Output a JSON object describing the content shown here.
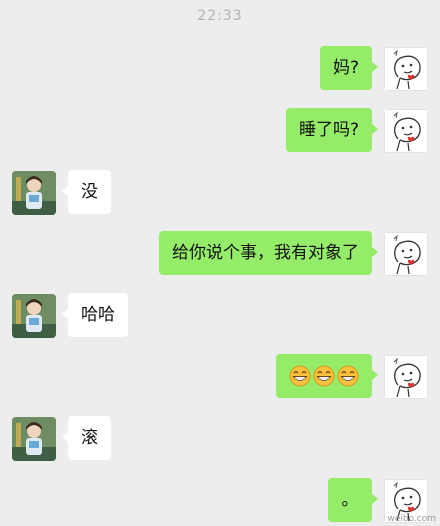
{
  "header": {
    "time": "22:33"
  },
  "messages": [
    {
      "side": "mine",
      "text": "妈?"
    },
    {
      "side": "mine",
      "text": "睡了吗?"
    },
    {
      "side": "theirs",
      "text": "没"
    },
    {
      "side": "mine",
      "text": "给你说个事，我有对象了"
    },
    {
      "side": "theirs",
      "text": "哈哈"
    },
    {
      "side": "mine",
      "text": "",
      "emoji": "grinning-face-emoji",
      "emoji_count": 3
    },
    {
      "side": "theirs",
      "text": "滚"
    },
    {
      "side": "mine",
      "text": "。"
    }
  ],
  "watermark": "weibo.com",
  "colors": {
    "background": "#ededed",
    "mine_bubble": "#95ec69",
    "theirs_bubble": "#ffffff",
    "time_text": "#b2b2b2"
  },
  "icons": {
    "mine_avatar": "doodle-face-with-heart-icon",
    "theirs_avatar": "person-photo-avatar"
  }
}
